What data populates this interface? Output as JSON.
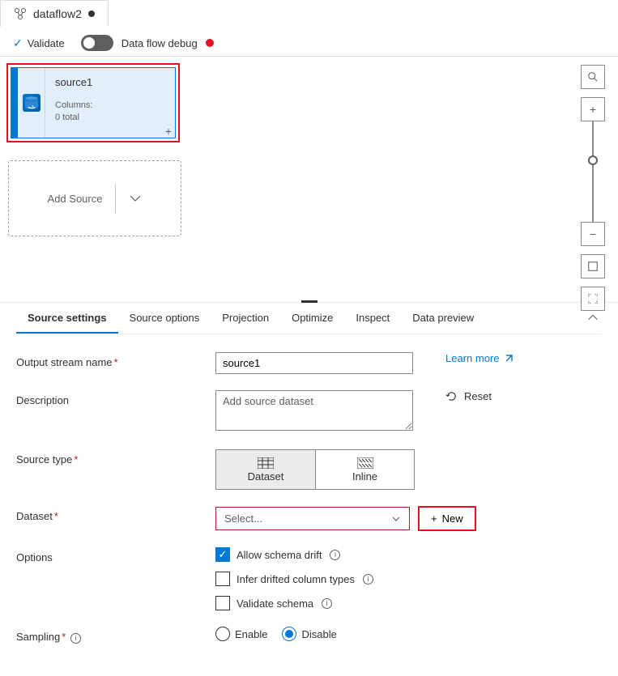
{
  "tab": {
    "title": "dataflow2"
  },
  "toolbar": {
    "validate": "Validate",
    "dataflow_debug": "Data flow debug"
  },
  "canvas": {
    "source": {
      "title": "source1",
      "columns_label": "Columns:",
      "columns_count": "0 total"
    },
    "add_source": "Add Source"
  },
  "settings": {
    "tabs": {
      "source_settings": "Source settings",
      "source_options": "Source options",
      "projection": "Projection",
      "optimize": "Optimize",
      "inspect": "Inspect",
      "data_preview": "Data preview"
    },
    "output_stream": {
      "label": "Output stream name",
      "value": "source1",
      "learn_more": "Learn more"
    },
    "description": {
      "label": "Description",
      "placeholder": "Add source dataset",
      "reset": "Reset"
    },
    "source_type": {
      "label": "Source type",
      "dataset": "Dataset",
      "inline": "Inline"
    },
    "dataset": {
      "label": "Dataset",
      "placeholder": "Select...",
      "new": "New"
    },
    "options": {
      "label": "Options",
      "allow_schema_drift": "Allow schema drift",
      "infer_drifted": "Infer drifted column types",
      "validate_schema": "Validate schema"
    },
    "sampling": {
      "label": "Sampling",
      "enable": "Enable",
      "disable": "Disable"
    }
  }
}
